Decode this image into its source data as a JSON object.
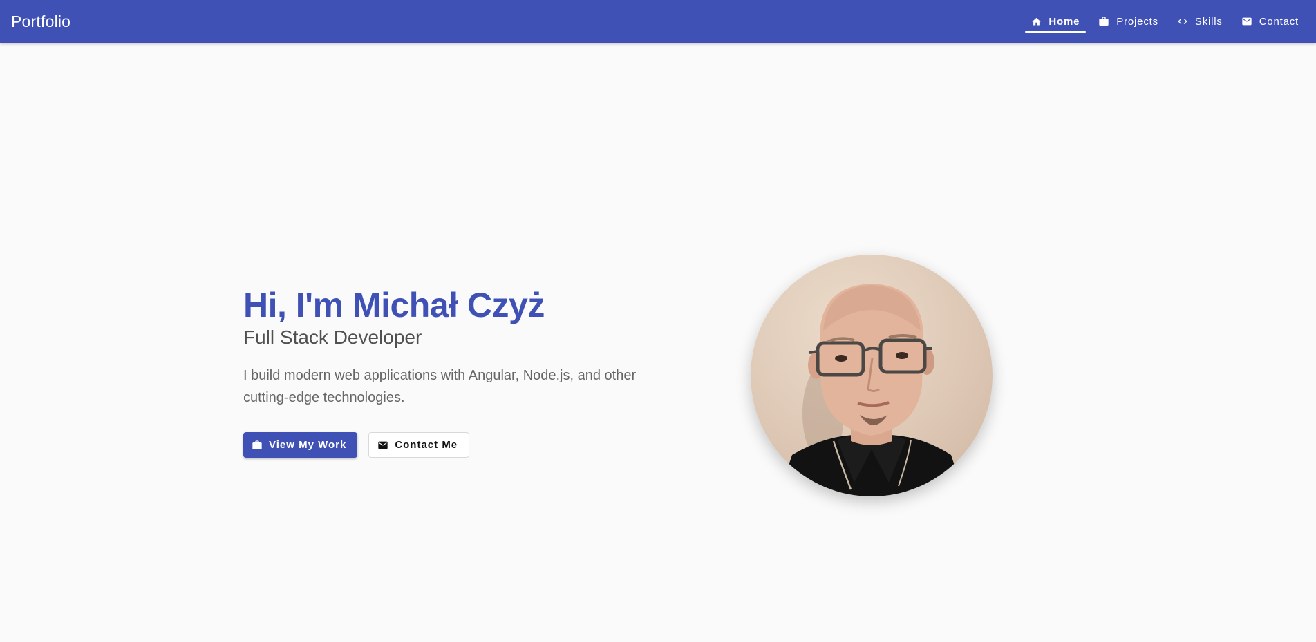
{
  "header": {
    "brand": "Portfolio",
    "nav": [
      {
        "label": "Home",
        "icon": "home-icon",
        "active": true
      },
      {
        "label": "Projects",
        "icon": "briefcase-icon",
        "active": false
      },
      {
        "label": "Skills",
        "icon": "code-icon",
        "active": false
      },
      {
        "label": "Contact",
        "icon": "mail-icon",
        "active": false
      }
    ]
  },
  "hero": {
    "greeting": "Hi, I'm Michał Czyż",
    "role": "Full Stack Developer",
    "intro": "I build modern web applications with Angular, Node.js, and other cutting-edge technologies.",
    "primary_button": {
      "label": "View My Work",
      "icon": "briefcase-icon"
    },
    "secondary_button": {
      "label": "Contact Me",
      "icon": "mail-icon"
    }
  },
  "colors": {
    "primary": "#3f51b5",
    "background": "#fafafa",
    "text_dark": "#505050",
    "text_muted": "#666666"
  }
}
